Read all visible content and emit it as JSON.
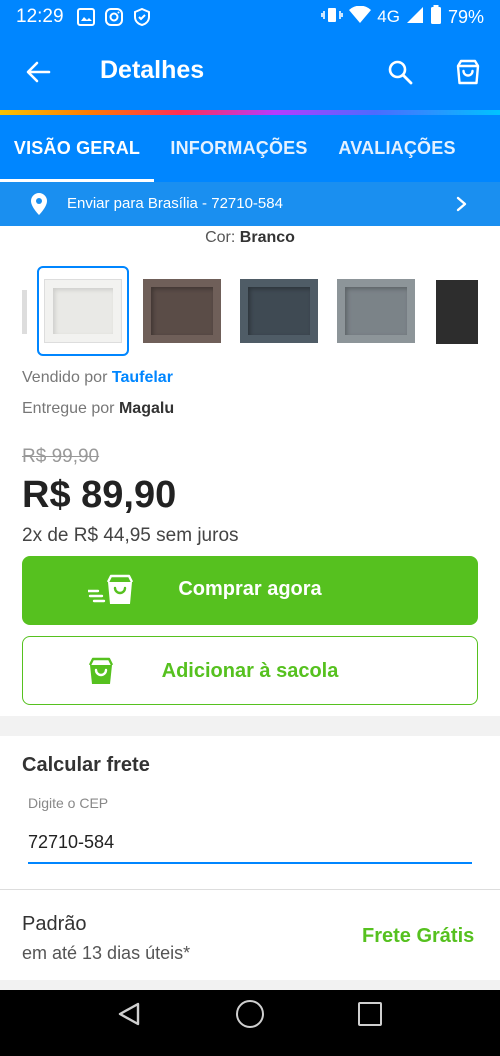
{
  "status": {
    "time": "12:29",
    "network": "4G",
    "battery": "79%"
  },
  "header": {
    "title": "Detalhes"
  },
  "tabs": [
    {
      "label": "VISÃO GERAL",
      "active": true
    },
    {
      "label": "INFORMAÇÕES",
      "active": false
    },
    {
      "label": "AVALIAÇÕES",
      "active": false
    }
  ],
  "delivery": {
    "text": "Enviar para Brasília - 72710-584"
  },
  "product": {
    "color_label": "Cor:",
    "color_value": "Branco",
    "swatches": [
      {
        "name": "branco",
        "color": "#f2f2f0",
        "inner": "#e6e6e3",
        "selected": true
      },
      {
        "name": "marrom",
        "color": "#6f5f59",
        "inner": "#5a4c47",
        "selected": false
      },
      {
        "name": "azul-cinza",
        "color": "#4f5c66",
        "inner": "#3f4a53",
        "selected": false
      },
      {
        "name": "cinza",
        "color": "#8d9599",
        "inner": "#7b8388",
        "selected": false
      },
      {
        "name": "preto",
        "color": "#2d2d2d",
        "inner": "#1f1f1f",
        "selected": false
      }
    ],
    "sold_by_label": "Vendido por",
    "seller": "Taufelar",
    "delivered_by_label": "Entregue por",
    "deliverer": "Magalu",
    "old_price": "R$ 99,90",
    "price": "R$ 89,90",
    "installments": "2x de R$ 44,95 sem juros"
  },
  "actions": {
    "buy_now": "Comprar agora",
    "add_to_bag": "Adicionar à sacola"
  },
  "shipping": {
    "title": "Calcular frete",
    "cep_label": "Digite o CEP",
    "cep_value": "72710-584",
    "option_name": "Padrão",
    "option_days": "em até 13 dias úteis*",
    "option_price": "Frete Grátis"
  },
  "colors": {
    "primary": "#0086ff",
    "green": "#56c11f"
  }
}
